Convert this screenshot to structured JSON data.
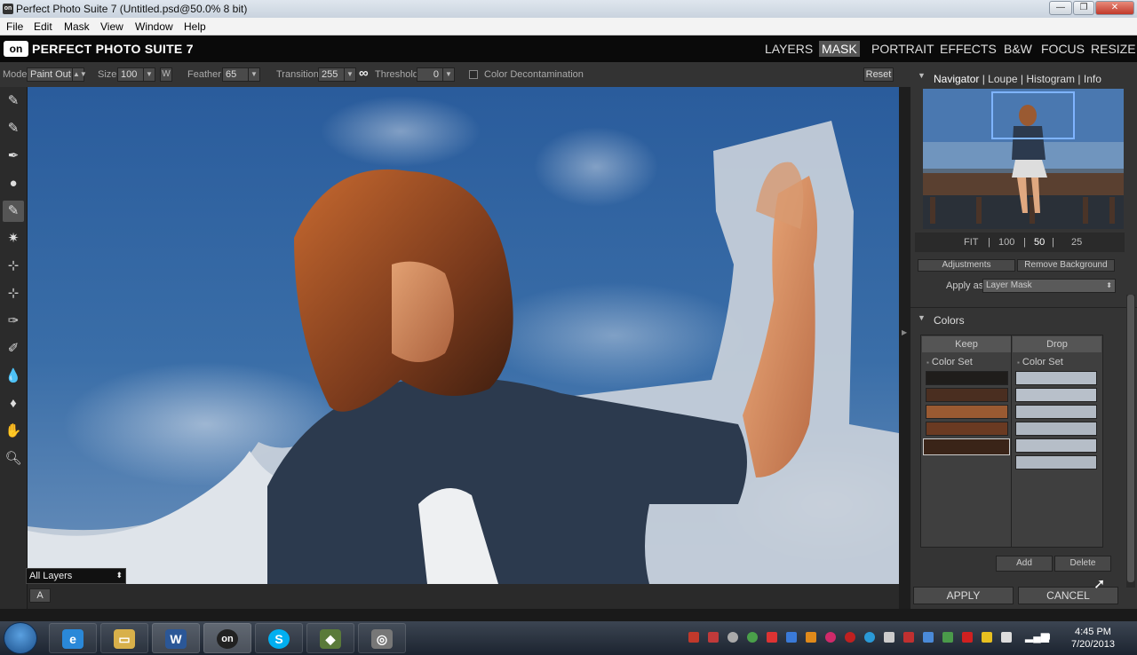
{
  "window": {
    "title": "Perfect Photo Suite 7 (Untitled.psd@50.0% 8 bit)",
    "controls": [
      "—",
      "❐",
      "✕"
    ]
  },
  "menu": [
    "File",
    "Edit",
    "Mask",
    "View",
    "Window",
    "Help"
  ],
  "app": {
    "logo": "on",
    "name": "PERFECT PHOTO SUITE 7",
    "modules": [
      "LAYERS",
      "MASK",
      "PORTRAIT",
      "EFFECTS",
      "B&W",
      "FOCUS",
      "RESIZE"
    ],
    "active_module": "MASK"
  },
  "options": {
    "mode_label": "Mode",
    "mode_value": "Paint Out",
    "size_label": "Size",
    "size_value": "100",
    "w_label": "W",
    "feather_label": "Feather",
    "feather_value": "65",
    "transition_label": "Transition",
    "transition_value": "255",
    "threshold_label": "Threshold",
    "threshold_value": "0",
    "link_glyph": "∞",
    "color_decon_label": "Color Decontamination",
    "color_decon_checked": false,
    "reset_label": "Reset"
  },
  "canvas": {
    "layer_select": "All Layers",
    "a_button": "A"
  },
  "navigator": {
    "tabs": [
      "Navigator",
      "Loupe",
      "Histogram",
      "Info"
    ],
    "separator": "|",
    "zoom_levels": [
      "FIT",
      "100",
      "50",
      "25"
    ],
    "active_zoom": "50"
  },
  "mask_panel": {
    "adjustments_label": "Adjustments",
    "remove_bg_label": "Remove Background",
    "apply_as_label": "Apply as",
    "apply_as_value": "Layer Mask"
  },
  "colors": {
    "title": "Colors",
    "keep_label": "Keep",
    "drop_label": "Drop",
    "keep_set": "Color Set",
    "drop_set": "Color Set",
    "keep_swatches": [
      "#1f1d1b",
      "#4a2e20",
      "#9a5a32",
      "#6a3a22",
      "#3a2418"
    ],
    "drop_swatches": [
      "#b4bcc6",
      "#b8c0ca",
      "#b2bac4",
      "#aeb6c0",
      "#b6bec8",
      "#b0b8c2"
    ],
    "add_label": "Add",
    "delete_label": "Delete"
  },
  "footer": {
    "apply_label": "APPLY",
    "cancel_label": "CANCEL"
  },
  "taskbar": {
    "apps": [
      {
        "name": "internet-explorer",
        "glyph": "e",
        "color": "#2a88d8"
      },
      {
        "name": "file-explorer",
        "glyph": "▭",
        "color": "#d8b04a"
      },
      {
        "name": "word",
        "glyph": "W",
        "color": "#2b5797"
      },
      {
        "name": "onone",
        "glyph": "on",
        "color": "#222222"
      },
      {
        "name": "skype",
        "glyph": "S",
        "color": "#00aff0"
      },
      {
        "name": "app-green",
        "glyph": "◆",
        "color": "#5a7a3a"
      },
      {
        "name": "app-record",
        "glyph": "◎",
        "color": "#777777"
      }
    ],
    "time": "4:45 PM",
    "date": "7/20/2013"
  }
}
